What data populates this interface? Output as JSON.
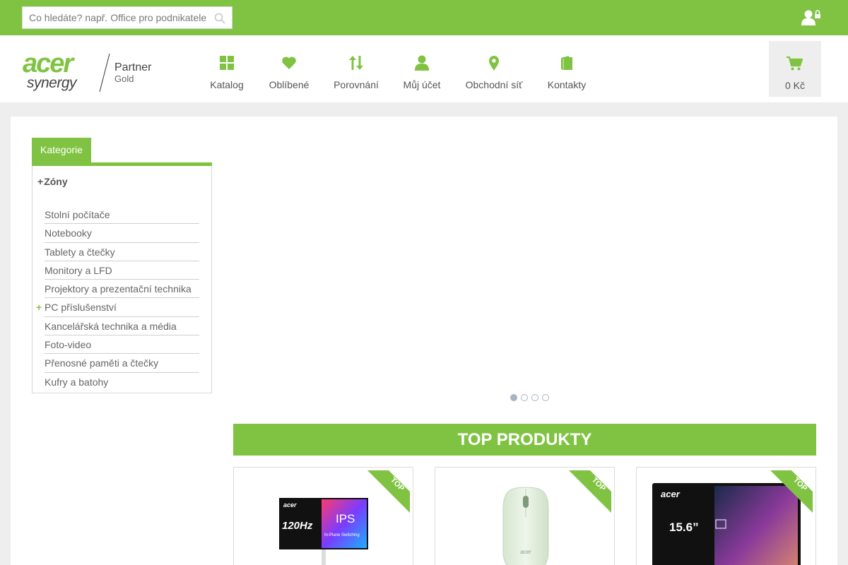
{
  "search": {
    "placeholder": "Co hledáte? např. Office pro podnikatele",
    "value": ""
  },
  "logo": {
    "brand": "acer",
    "sub": "synergy",
    "partner": "Partner",
    "level": "Gold"
  },
  "nav": [
    {
      "label": "Katalog",
      "icon": "grid-icon"
    },
    {
      "label": "Oblíbené",
      "icon": "heart-icon"
    },
    {
      "label": "Porovnání",
      "icon": "sort-arrows-icon"
    },
    {
      "label": "Můj účet",
      "icon": "user-icon"
    },
    {
      "label": "Obchodní síť",
      "icon": "map-pin-icon"
    },
    {
      "label": "Kontakty",
      "icon": "book-icon"
    }
  ],
  "cart": {
    "label": "0 Kč",
    "icon": "cart-icon"
  },
  "sidebar": {
    "tab": "Kategorie",
    "zones": "Zóny",
    "items": [
      {
        "label": "Stolní počítače",
        "expandable": false
      },
      {
        "label": "Notebooky",
        "expandable": false
      },
      {
        "label": "Tablety a čtečky",
        "expandable": false
      },
      {
        "label": "Monitory a LFD",
        "expandable": false
      },
      {
        "label": "Projektory a prezentační technika",
        "expandable": false
      },
      {
        "label": "PC příslušenství",
        "expandable": true
      },
      {
        "label": "Kancelářská technika a média",
        "expandable": false
      },
      {
        "label": "Foto-video",
        "expandable": false
      },
      {
        "label": "Přenosné paměti a čtečky",
        "expandable": false
      },
      {
        "label": "Kufry a batohy",
        "expandable": false
      }
    ]
  },
  "slider": {
    "dots": 4,
    "active": 0
  },
  "top_products": {
    "title": "TOP PRODUKTY",
    "badge": "TOP",
    "items": [
      {
        "image": "monitor-image",
        "screen_brand": "acer",
        "screen_text_1": "120Hz",
        "screen_text_2": "IPS",
        "screen_text_3": "In-Plane Switching"
      },
      {
        "image": "mouse-image",
        "brand": "acer"
      },
      {
        "image": "portable-monitor-image",
        "screen_brand": "acer",
        "screen_text_1": "15.6”"
      }
    ]
  },
  "colors": {
    "brand_green": "#80c342",
    "background": "#eeeeee",
    "text": "#555555"
  }
}
